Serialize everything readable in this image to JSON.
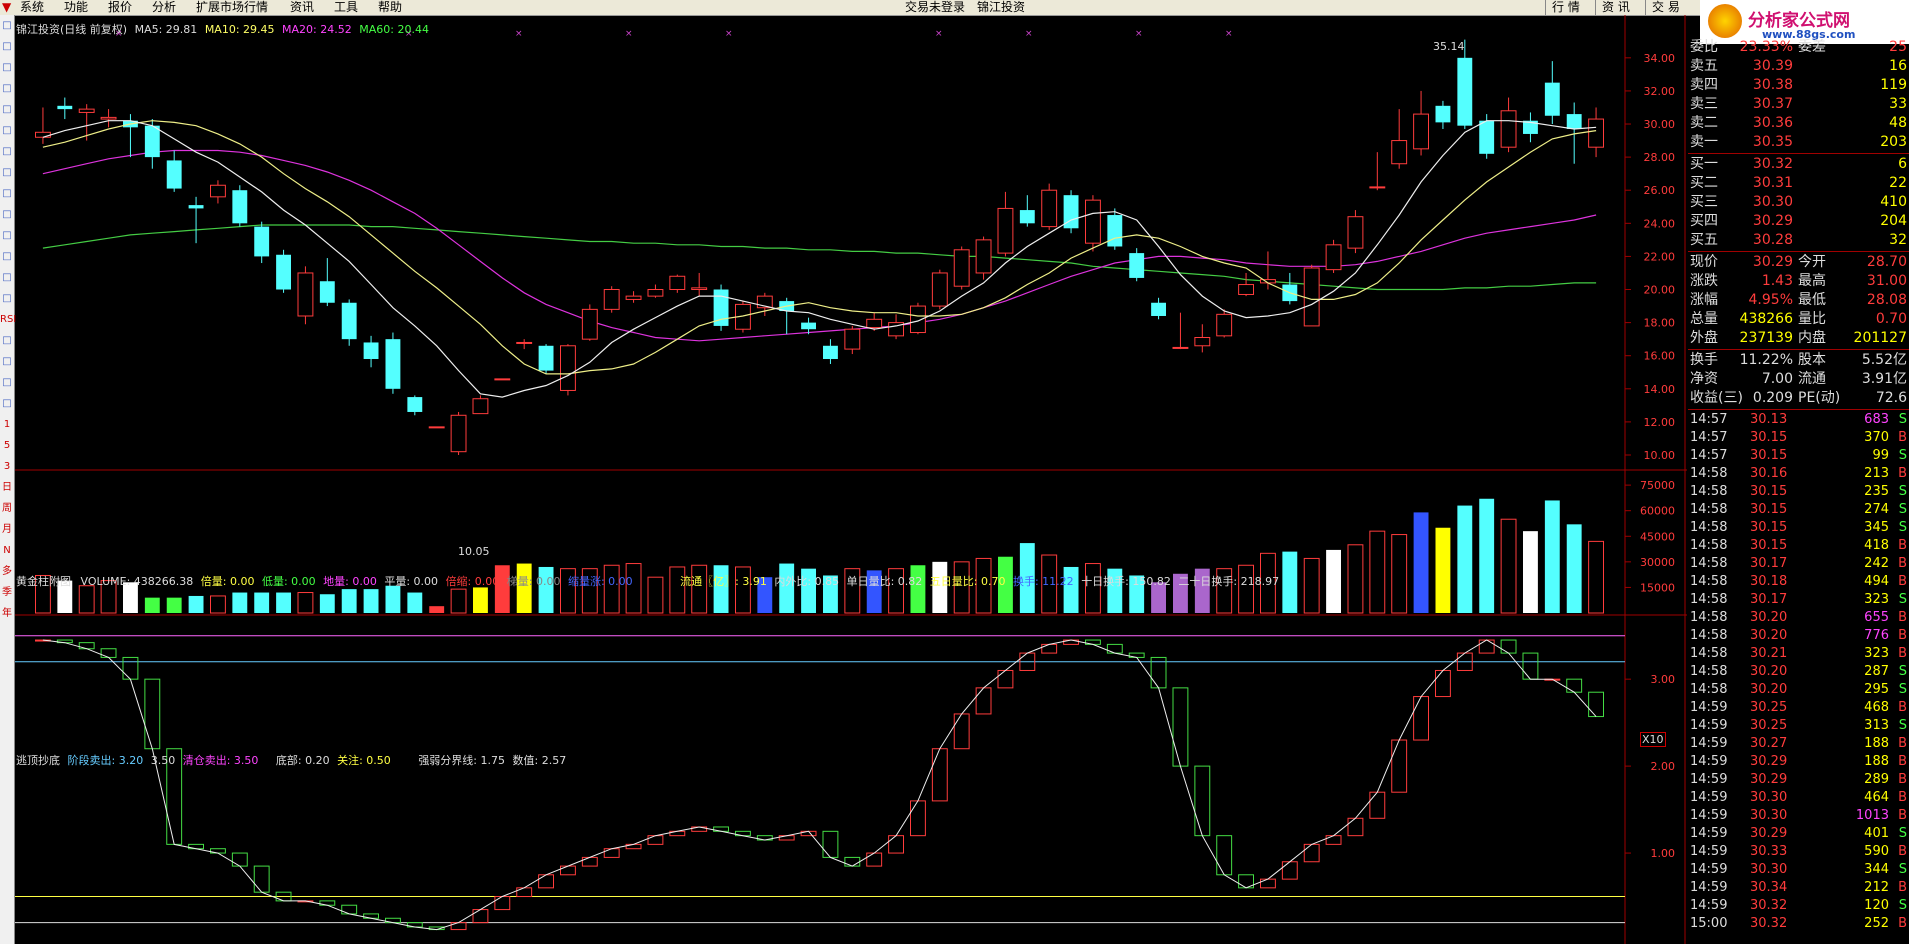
{
  "menu": [
    "系统",
    "功能",
    "报价",
    "分析",
    "扩展市场行情",
    "资讯",
    "工具",
    "帮助"
  ],
  "center_title": "交易未登录　锦江投资",
  "right_menu": [
    "行 情",
    "资 讯",
    "交 易"
  ],
  "logo": {
    "name": "分析家公式网",
    "url": "www.88gs.com"
  },
  "left_tools": [
    "",
    "",
    "",
    "",
    "",
    "",
    "",
    "",
    "",
    "",
    "",
    "",
    "",
    "",
    "RSI",
    "",
    "",
    "",
    "",
    "1",
    "5",
    "3",
    "日",
    "周",
    "月",
    "N",
    "多",
    "季",
    "年"
  ],
  "main_header": {
    "title": "锦江投资(日线 前复权)",
    "ma5": "MA5: 29.81",
    "ma10": "MA10: 29.45",
    "ma20": "MA20: 24.52",
    "ma60": "MA60: 20.44",
    "high_label": "35.14",
    "low_label": "10.05"
  },
  "price_axis": [
    "34.00",
    "32.00",
    "30.00",
    "28.00",
    "26.00",
    "24.00",
    "22.00",
    "20.00",
    "18.00",
    "16.00",
    "14.00",
    "12.00",
    "10.00"
  ],
  "vol_header": {
    "name": "黄金柱附图",
    "volume": "VOLUME: 438266.38",
    "i1": "倍量: 0.00",
    "i2": "低量: 0.00",
    "i3": "地量: 0.00",
    "i4": "平量: 0.00",
    "i5": "倍缩: 0.00",
    "i6": "梯量: 0.00",
    "i7": "缩量涨: 0.00",
    "i8": "流通〖亿〗: 3.91",
    "i9": "内外比: 0.85",
    "i10": "单日量比: 0.82",
    "i11": "五日量比: 0.70",
    "i12": "换手: 11.22",
    "i13": "十日换手: 150.82",
    "i14": "二十日换手: 218.97"
  },
  "vol_axis": [
    "75000",
    "60000",
    "45000",
    "30000",
    "15000"
  ],
  "vol_unit": "X10",
  "ind_header": {
    "name": "逃顶抄底",
    "i1": "阶段卖出: 3.20",
    "i2": "3.50",
    "i3": "清仓卖出: 3.50",
    "i4": "底部: 0.20",
    "i5": "关注: 0.50",
    "i6": "强弱分界线: 1.75",
    "i7": "数值: 2.57"
  },
  "ind_axis": [
    "3.00",
    "2.00",
    "1.00"
  ],
  "quote": {
    "top": [
      [
        "委比",
        "23.33%",
        "委差",
        "25"
      ]
    ],
    "sells": [
      [
        "卖五",
        "30.39",
        "16"
      ],
      [
        "卖四",
        "30.38",
        "119"
      ],
      [
        "卖三",
        "30.37",
        "33"
      ],
      [
        "卖二",
        "30.36",
        "48"
      ],
      [
        "卖一",
        "30.35",
        "203"
      ]
    ],
    "buys": [
      [
        "买一",
        "30.32",
        "6"
      ],
      [
        "买二",
        "30.31",
        "22"
      ],
      [
        "买三",
        "30.30",
        "410"
      ],
      [
        "买四",
        "30.29",
        "204"
      ],
      [
        "买五",
        "30.28",
        "32"
      ]
    ],
    "stats": [
      [
        "现价",
        "30.29",
        "今开",
        "28.70"
      ],
      [
        "涨跌",
        "1.43",
        "最高",
        "31.00"
      ],
      [
        "涨幅",
        "4.95%",
        "最低",
        "28.08"
      ],
      [
        "总量",
        "438266",
        "量比",
        "0.70"
      ],
      [
        "外盘",
        "237139",
        "内盘",
        "201127"
      ],
      [
        "换手",
        "11.22%",
        "股本",
        "5.52亿"
      ],
      [
        "净资",
        "7.00",
        "流通",
        "3.91亿"
      ],
      [
        "收益(三)",
        "0.209",
        "PE(动)",
        "72.6"
      ]
    ]
  },
  "ticks": [
    [
      "14:57",
      "30.13",
      "683",
      "S"
    ],
    [
      "14:57",
      "30.15",
      "370",
      "B"
    ],
    [
      "14:57",
      "30.15",
      "99",
      "S"
    ],
    [
      "14:58",
      "30.16",
      "213",
      "B"
    ],
    [
      "14:58",
      "30.15",
      "235",
      "S"
    ],
    [
      "14:58",
      "30.15",
      "274",
      "S"
    ],
    [
      "14:58",
      "30.15",
      "345",
      "S"
    ],
    [
      "14:58",
      "30.15",
      "418",
      "B"
    ],
    [
      "14:58",
      "30.17",
      "242",
      "B"
    ],
    [
      "14:58",
      "30.18",
      "494",
      "B"
    ],
    [
      "14:58",
      "30.17",
      "323",
      "S"
    ],
    [
      "14:58",
      "30.20",
      "655",
      "B"
    ],
    [
      "14:58",
      "30.20",
      "776",
      "B"
    ],
    [
      "14:58",
      "30.21",
      "323",
      "B"
    ],
    [
      "14:58",
      "30.20",
      "287",
      "S"
    ],
    [
      "14:58",
      "30.20",
      "295",
      "S"
    ],
    [
      "14:59",
      "30.25",
      "468",
      "B"
    ],
    [
      "14:59",
      "30.25",
      "313",
      "S"
    ],
    [
      "14:59",
      "30.27",
      "188",
      "B"
    ],
    [
      "14:59",
      "30.29",
      "188",
      "B"
    ],
    [
      "14:59",
      "30.29",
      "289",
      "B"
    ],
    [
      "14:59",
      "30.30",
      "464",
      "B"
    ],
    [
      "14:59",
      "30.30",
      "1013",
      "B"
    ],
    [
      "14:59",
      "30.29",
      "401",
      "S"
    ],
    [
      "14:59",
      "30.33",
      "590",
      "B"
    ],
    [
      "14:59",
      "30.30",
      "344",
      "S"
    ],
    [
      "14:59",
      "30.34",
      "212",
      "B"
    ],
    [
      "14:59",
      "30.32",
      "120",
      "S"
    ],
    [
      "15:00",
      "30.32",
      "252",
      "B"
    ]
  ],
  "chart_data": {
    "type": "candlestick",
    "ylim": [
      10,
      35.5
    ],
    "candles": [
      [
        29.2,
        29.5,
        31.0,
        28.8
      ],
      [
        31.1,
        30.9,
        31.6,
        30.3
      ],
      [
        30.7,
        30.9,
        31.2,
        29.0
      ],
      [
        30.3,
        30.4,
        30.9,
        29.8
      ],
      [
        30.2,
        29.8,
        30.6,
        28.0
      ],
      [
        29.9,
        28.0,
        30.3,
        27.3
      ],
      [
        27.8,
        26.1,
        28.4,
        25.9
      ],
      [
        25.1,
        24.9,
        25.6,
        22.8
      ],
      [
        25.6,
        26.3,
        26.6,
        25.2
      ],
      [
        26.0,
        24.0,
        26.3,
        23.8
      ],
      [
        23.8,
        22.0,
        24.1,
        21.6
      ],
      [
        22.1,
        20.0,
        22.4,
        19.8
      ],
      [
        18.4,
        21.0,
        21.4,
        17.9
      ],
      [
        20.5,
        19.2,
        21.9,
        19.0
      ],
      [
        19.2,
        17.0,
        19.4,
        16.6
      ],
      [
        16.8,
        15.8,
        17.2,
        15.3
      ],
      [
        17.0,
        14.0,
        17.4,
        13.7
      ],
      [
        13.5,
        12.6,
        13.6,
        12.4
      ],
      [
        11.7,
        11.7,
        11.7,
        11.7
      ],
      [
        10.2,
        12.4,
        12.6,
        10.0
      ],
      [
        12.5,
        13.4,
        13.6,
        12.5
      ],
      [
        14.6,
        14.6,
        14.6,
        14.6
      ],
      [
        16.8,
        16.8,
        17.0,
        16.4
      ],
      [
        16.6,
        15.1,
        16.7,
        14.9
      ],
      [
        13.9,
        16.6,
        16.7,
        13.6
      ],
      [
        17.0,
        18.8,
        19.1,
        16.9
      ],
      [
        18.8,
        20.0,
        20.2,
        18.6
      ],
      [
        19.4,
        19.6,
        19.9,
        19.2
      ],
      [
        19.6,
        20.0,
        20.3,
        19.5
      ],
      [
        20.0,
        20.8,
        20.9,
        19.8
      ],
      [
        20.0,
        20.1,
        21.0,
        19.6
      ],
      [
        20.0,
        17.8,
        20.3,
        17.5
      ],
      [
        17.6,
        19.1,
        19.3,
        17.4
      ],
      [
        18.9,
        19.6,
        19.8,
        18.4
      ],
      [
        19.3,
        18.7,
        19.5,
        17.3
      ],
      [
        18.0,
        17.6,
        18.3,
        17.3
      ],
      [
        16.6,
        15.8,
        17.0,
        15.5
      ],
      [
        16.4,
        17.6,
        17.8,
        16.1
      ],
      [
        17.7,
        18.2,
        18.6,
        17.5
      ],
      [
        17.2,
        18.0,
        18.5,
        17.0
      ],
      [
        17.4,
        19.0,
        19.2,
        17.3
      ],
      [
        19.0,
        21.0,
        21.2,
        18.8
      ],
      [
        20.2,
        22.4,
        22.6,
        20.0
      ],
      [
        21.0,
        23.0,
        23.2,
        20.6
      ],
      [
        22.2,
        24.9,
        25.9,
        22.0
      ],
      [
        24.8,
        24.0,
        25.7,
        23.8
      ],
      [
        23.8,
        26.0,
        26.4,
        23.6
      ],
      [
        25.7,
        23.7,
        26.0,
        23.4
      ],
      [
        22.8,
        25.4,
        25.7,
        22.3
      ],
      [
        24.5,
        22.6,
        24.9,
        22.4
      ],
      [
        22.2,
        20.7,
        22.5,
        20.5
      ],
      [
        19.2,
        18.4,
        19.5,
        18.2
      ],
      [
        16.5,
        16.5,
        18.6,
        16.4
      ],
      [
        16.6,
        17.1,
        17.9,
        16.2
      ],
      [
        17.2,
        18.5,
        18.8,
        17.1
      ],
      [
        19.7,
        20.3,
        21.0,
        19.6
      ],
      [
        20.4,
        20.6,
        22.3,
        20.0
      ],
      [
        20.3,
        19.3,
        21.0,
        19.1
      ],
      [
        17.8,
        21.3,
        21.5,
        17.8
      ],
      [
        21.2,
        22.7,
        23.0,
        21.0
      ],
      [
        22.5,
        24.4,
        24.8,
        22.2
      ],
      [
        26.2,
        26.2,
        28.3,
        26.0
      ],
      [
        27.6,
        29.0,
        30.9,
        27.3
      ],
      [
        28.5,
        30.6,
        32.0,
        28.1
      ],
      [
        31.1,
        30.1,
        31.4,
        29.7
      ],
      [
        34.0,
        29.9,
        35.1,
        29.7
      ],
      [
        30.2,
        28.2,
        30.6,
        27.9
      ],
      [
        28.6,
        30.8,
        31.6,
        28.3
      ],
      [
        30.2,
        29.4,
        30.7,
        28.9
      ],
      [
        32.5,
        30.5,
        33.8,
        30.0
      ],
      [
        30.6,
        29.7,
        31.3,
        27.6
      ],
      [
        28.6,
        30.3,
        31.0,
        28.0
      ]
    ],
    "volumes": [
      22,
      19,
      16,
      19,
      18,
      9,
      9,
      10,
      10,
      12,
      12,
      12,
      12,
      11,
      14,
      14,
      16,
      12,
      4,
      14,
      15,
      28,
      29,
      27,
      26,
      26,
      28,
      29,
      21,
      27,
      28,
      28,
      27,
      21,
      29,
      26,
      22,
      26,
      25,
      26,
      28,
      30,
      30,
      32,
      33,
      41,
      34,
      27,
      29,
      26,
      22,
      18,
      23,
      26,
      26,
      28,
      35,
      36,
      32,
      37,
      40,
      48,
      46,
      59,
      50,
      63,
      67,
      55,
      48,
      66,
      52,
      42
    ],
    "ma5": [
      29.2,
      29.6,
      29.9,
      30.2,
      30.2,
      29.9,
      29.1,
      28.3,
      27.7,
      26.8,
      25.9,
      24.8,
      23.9,
      22.8,
      21.7,
      20.3,
      18.9,
      17.8,
      16.6,
      15.1,
      13.7,
      13.5,
      13.9,
      14.2,
      14.8,
      15.6,
      16.8,
      17.6,
      18.3,
      19.0,
      19.6,
      19.6,
      19.3,
      19.0,
      18.7,
      18.6,
      18.2,
      17.9,
      17.6,
      17.8,
      18.1,
      18.7,
      19.6,
      20.4,
      21.6,
      22.6,
      23.4,
      24.2,
      24.6,
      24.7,
      24.2,
      22.6,
      20.9,
      19.6,
      18.7,
      18.3,
      18.4,
      18.6,
      19.1,
      19.9,
      21.0,
      22.7,
      24.5,
      26.5,
      28.1,
      29.5,
      30.2,
      30.2,
      30.1,
      29.9,
      29.7,
      29.8
    ],
    "ma10": [
      28.6,
      28.9,
      29.3,
      29.7,
      30.0,
      30.2,
      30.1,
      29.9,
      29.4,
      28.8,
      28.0,
      27.0,
      26.1,
      25.3,
      24.4,
      23.3,
      22.2,
      21.1,
      20.1,
      19.0,
      17.9,
      16.6,
      15.5,
      14.9,
      14.9,
      15.1,
      15.2,
      15.5,
      16.2,
      17.0,
      17.8,
      18.2,
      18.4,
      18.7,
      19.0,
      19.2,
      18.9,
      18.7,
      18.6,
      18.6,
      18.4,
      18.4,
      18.5,
      18.9,
      19.5,
      20.3,
      21.0,
      21.9,
      22.5,
      23.1,
      23.3,
      23.1,
      22.6,
      22.0,
      21.6,
      21.3,
      20.4,
      19.8,
      19.4,
      19.4,
      19.7,
      20.4,
      21.6,
      23.0,
      24.2,
      25.4,
      26.5,
      27.4,
      28.3,
      29.1,
      29.4,
      29.6
    ],
    "ma20": [
      27.0,
      27.3,
      27.6,
      27.9,
      28.1,
      28.3,
      28.4,
      28.4,
      28.4,
      28.3,
      28.1,
      27.8,
      27.5,
      27.1,
      26.6,
      26.0,
      25.3,
      24.6,
      23.7,
      22.7,
      21.7,
      20.7,
      19.8,
      19.1,
      18.6,
      18.1,
      17.7,
      17.4,
      17.1,
      17.0,
      16.9,
      17.0,
      17.1,
      17.2,
      17.3,
      17.4,
      17.5,
      17.6,
      17.7,
      17.8,
      18.0,
      18.2,
      18.5,
      18.9,
      19.3,
      19.8,
      20.3,
      20.8,
      21.2,
      21.6,
      21.8,
      22.0,
      22.0,
      21.9,
      21.8,
      21.6,
      21.5,
      21.4,
      21.4,
      21.4,
      21.5,
      21.7,
      22.0,
      22.3,
      22.7,
      23.1,
      23.4,
      23.6,
      23.8,
      24.0,
      24.2,
      24.5
    ],
    "ma60": [
      22.5,
      22.7,
      22.9,
      23.1,
      23.3,
      23.4,
      23.5,
      23.6,
      23.7,
      23.8,
      23.9,
      23.9,
      23.9,
      23.9,
      23.9,
      23.8,
      23.8,
      23.7,
      23.6,
      23.5,
      23.4,
      23.3,
      23.2,
      23.1,
      23.0,
      22.9,
      22.9,
      22.8,
      22.8,
      22.7,
      22.7,
      22.6,
      22.6,
      22.5,
      22.5,
      22.4,
      22.4,
      22.3,
      22.3,
      22.2,
      22.2,
      22.1,
      22.0,
      22.0,
      21.9,
      21.8,
      21.7,
      21.6,
      21.4,
      21.3,
      21.2,
      21.1,
      21.0,
      20.9,
      20.8,
      20.6,
      20.5,
      20.4,
      20.3,
      20.2,
      20.1,
      20.0,
      20.0,
      20.0,
      20.0,
      20.1,
      20.1,
      20.2,
      20.2,
      20.3,
      20.4,
      20.4
    ],
    "indicator": [
      3.45,
      3.42,
      3.35,
      3.25,
      3.0,
      2.2,
      1.1,
      1.05,
      1.0,
      0.85,
      0.55,
      0.45,
      0.45,
      0.4,
      0.3,
      0.25,
      0.2,
      0.15,
      0.12,
      0.2,
      0.35,
      0.5,
      0.6,
      0.75,
      0.85,
      0.95,
      1.05,
      1.1,
      1.2,
      1.25,
      1.3,
      1.25,
      1.2,
      1.15,
      1.2,
      1.25,
      0.95,
      0.85,
      1.0,
      1.2,
      1.6,
      2.2,
      2.6,
      2.9,
      3.1,
      3.3,
      3.4,
      3.45,
      3.4,
      3.3,
      3.25,
      2.9,
      2.0,
      1.2,
      0.75,
      0.6,
      0.7,
      0.9,
      1.1,
      1.2,
      1.4,
      1.7,
      2.3,
      2.8,
      3.1,
      3.3,
      3.45,
      3.3,
      3.0,
      3.0,
      2.85,
      2.57
    ]
  }
}
